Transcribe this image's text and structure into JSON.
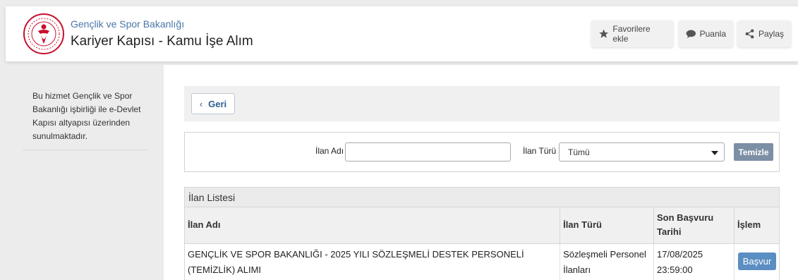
{
  "header": {
    "ministry": "Gençlik ve Spor Bakanlığı",
    "service_title": "Kariyer Kapısı - Kamu İşe Alım",
    "favorites_label": "Favorilere ekle",
    "rate_label": "Puanla",
    "share_label": "Paylaş"
  },
  "sidebar": {
    "text": "Bu hizmet Gençlik ve Spor Bakanlığı işbirliği ile e-Devlet Kapısı altyapısı üzerinden sunulmaktadır."
  },
  "back": {
    "label": "Geri"
  },
  "filter": {
    "name_label": "İlan Adı",
    "name_value": "",
    "type_label": "İlan Türü",
    "type_selected": "Tümü",
    "clear_label": "Temizle"
  },
  "list": {
    "title": "İlan Listesi",
    "columns": [
      "İlan Adı",
      "İlan Türü",
      "Son Başvuru Tarihi",
      "İşlem"
    ],
    "rows": [
      {
        "name": "GENÇLİK VE SPOR BAKANLIĞI - 2025 YILI SÖZLEŞMELİ DESTEK PERSONELİ (TEMİZLİK) ALIMI",
        "type": "Sözleşmeli Personel İlanları",
        "deadline": "17/08/2025 23:59:00",
        "action": "Başvur"
      }
    ]
  },
  "colors": {
    "accent_blue": "#4a77a8",
    "apply_button": "#5b8ec2",
    "clear_button": "#7d8fa5",
    "logo_red": "#c8102e"
  }
}
